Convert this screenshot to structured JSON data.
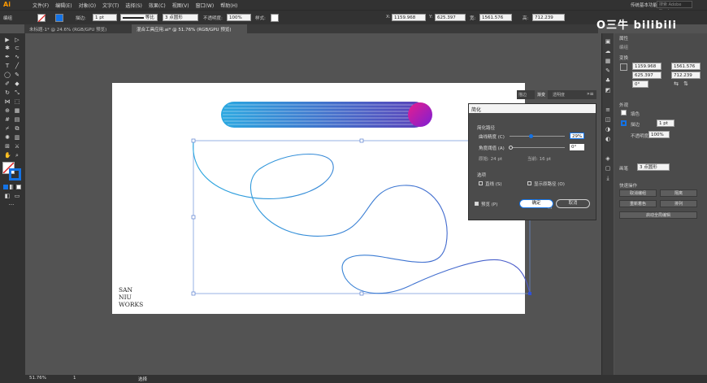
{
  "app": {
    "logo": "Ai"
  },
  "menu": [
    "文件(F)",
    "编辑(E)",
    "对象(O)",
    "文字(T)",
    "选择(S)",
    "效果(C)",
    "视图(V)",
    "窗口(W)",
    "帮助(H)"
  ],
  "menubar_right": {
    "workspace": "传统基本功能",
    "search_placeholder": "搜索 Adobe Stock"
  },
  "control_bar": {
    "selection_label": "编组",
    "stroke_label": "描边:",
    "stroke_value": "1 pt",
    "line_style": "等比",
    "brush_value": "3 点圆形",
    "opacity_label": "不透明度:",
    "opacity_value": "100%",
    "style_label": "样式:",
    "x_label": "X:",
    "x_value": "1159.968",
    "y_label": "Y:",
    "y_value": "625.397",
    "w_label": "宽:",
    "w_value": "1561.576",
    "h_label": "高:",
    "h_value": "712.239"
  },
  "tabs": [
    {
      "label": "未标题-1* @ 24.6% (RGB/GPU 预览)",
      "active": false
    },
    {
      "label": "混合工具应用.ai* @ 51.76% (RGB/GPU 预览)",
      "active": true
    }
  ],
  "artboard": {
    "logo_lines": [
      "SAN",
      "NIU",
      "WORKS"
    ]
  },
  "float_panel_tabs": [
    "描边",
    "渐变",
    "透明度"
  ],
  "dialog": {
    "title": "简化",
    "section_simplify": "简化路径",
    "curve_precision_label": "曲线精度 (C)",
    "curve_precision_value": "29%",
    "corner_angle_label": "角度阈值 (A)",
    "corner_angle_value": "0°",
    "original_label": "原始: 24 pt",
    "current_label": "当前: 16 pt",
    "options_title": "选项",
    "straight_lines_label": "直线 (S)",
    "show_original_label": "显示原路径 (O)",
    "preview_label": "预览 (P)",
    "preview_checked": true,
    "ok_label": "确定",
    "cancel_label": "取消"
  },
  "right_panel": {
    "tab_title": "属性",
    "group_label": "编组",
    "transform_title": "变换",
    "x_value": "1159.968",
    "y_value": "625.397",
    "w_value": "1561.576",
    "h_value": "712.239",
    "angle_value": "0°",
    "appearance_title": "外观",
    "stroke_title": "描边",
    "fill_label": "填色",
    "stroke_label": "描边",
    "stroke_value": "1 pt",
    "opacity_label": "不透明度",
    "opacity_value": "100%",
    "brush_label": "画笔",
    "brush_value": "3 点圆形",
    "quick_actions_title": "快速操作",
    "btn_ungroup": "取消编组",
    "btn_isolate": "隔离",
    "btn_recolor": "重新着色",
    "btn_arrange": "排列",
    "btn_global_edit": "启动全局编辑"
  },
  "statusbar": {
    "zoom": "51.76%",
    "page": "1",
    "tool": "选择"
  },
  "watermark": {
    "text": "O三牛 bilibili"
  },
  "colors": {
    "accent": "#1473e6",
    "gradient_start": "#2aa8e0",
    "gradient_end": "#5a3fb8",
    "circle_start": "#e81e8c",
    "circle_end": "#7b1fd6"
  }
}
